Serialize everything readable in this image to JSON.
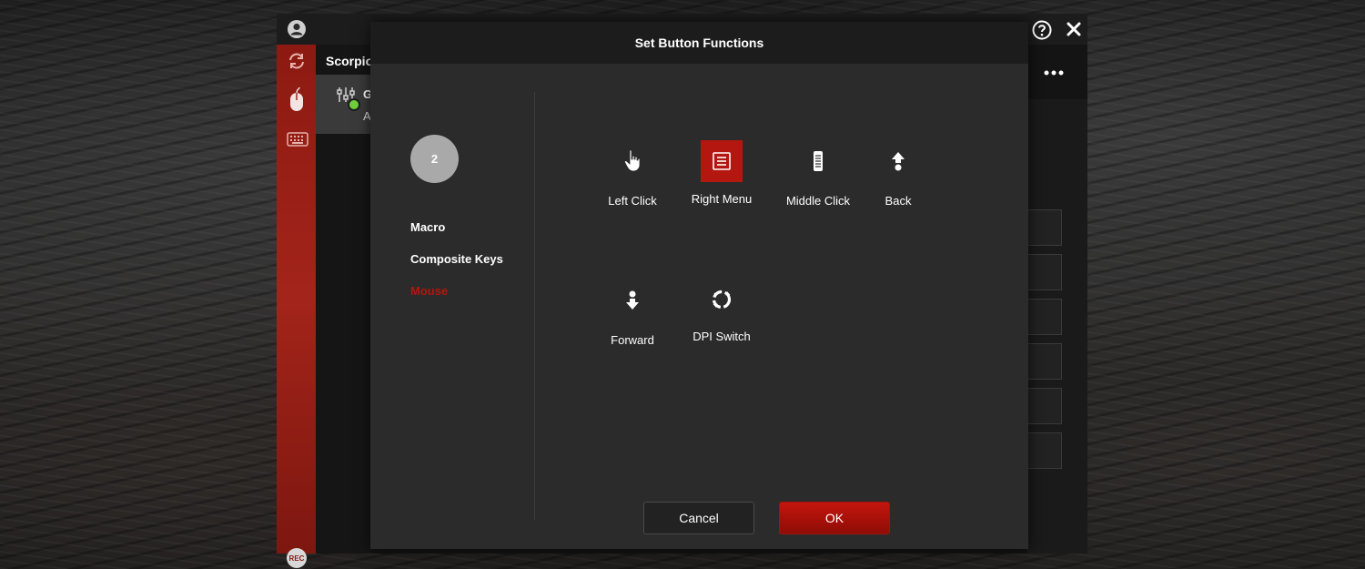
{
  "app": {
    "list_title": "Scorpion",
    "list_item_name": "G",
    "list_item_sub": "A",
    "rec_label": "REC"
  },
  "dialog": {
    "title": "Set Button Functions",
    "button_number": "2",
    "categories": [
      {
        "label": "Macro",
        "active": false
      },
      {
        "label": "Composite Keys",
        "active": false
      },
      {
        "label": "Mouse",
        "active": true
      }
    ],
    "functions": [
      {
        "label": "Left Click",
        "icon": "hand-pointer-icon",
        "selected": false
      },
      {
        "label": "Right Menu",
        "icon": "menu-list-icon",
        "selected": true
      },
      {
        "label": "Middle Click",
        "icon": "scroll-wheel-icon",
        "selected": false
      },
      {
        "label": "Back",
        "icon": "arrow-up-icon",
        "selected": false
      },
      {
        "label": "Forward",
        "icon": "arrow-down-icon",
        "selected": false
      },
      {
        "label": "DPI Switch",
        "icon": "dpi-cycle-icon",
        "selected": false
      }
    ],
    "cancel_label": "Cancel",
    "ok_label": "OK"
  },
  "colors": {
    "accent": "#b41710",
    "sidebar": "#a3241a",
    "dialog_bg": "#2b2b2b"
  }
}
